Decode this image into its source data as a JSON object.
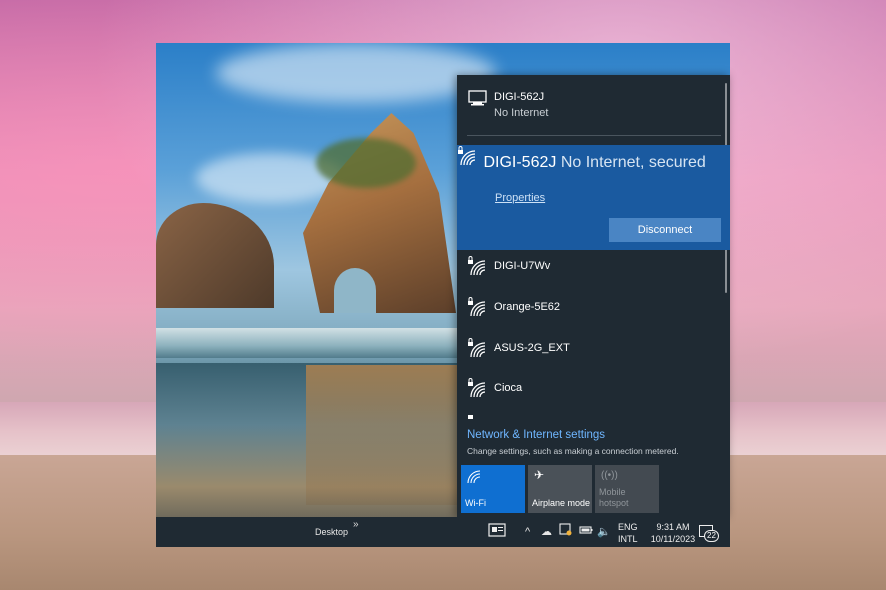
{
  "networks": [
    {
      "name": "DIGI-562J",
      "status": "No Internet",
      "icon": "ethernet-icon",
      "secured": false
    },
    {
      "name": "DIGI-562J",
      "status": "No Internet, secured",
      "icon": "wifi-secured-icon",
      "secured": true,
      "selected": true
    },
    {
      "name": "DIGI-U7Wv",
      "status": "",
      "icon": "wifi-secured-icon",
      "secured": true
    },
    {
      "name": "Orange-5E62",
      "status": "",
      "icon": "wifi-secured-icon",
      "secured": true
    },
    {
      "name": "ASUS-2G_EXT",
      "status": "",
      "icon": "wifi-secured-icon",
      "secured": true
    },
    {
      "name": "Cioca",
      "status": "",
      "icon": "wifi-secured-icon",
      "secured": true
    }
  ],
  "selected_network": {
    "properties_label": "Properties",
    "disconnect_label": "Disconnect"
  },
  "settings": {
    "link": "Network & Internet settings",
    "description": "Change settings, such as making a connection metered."
  },
  "quick_actions": [
    {
      "label": "Wi-Fi",
      "icon": "wifi-icon",
      "active": true
    },
    {
      "label": "Airplane mode",
      "icon": "airplane-icon",
      "active": false
    },
    {
      "label": "Mobile hotspot",
      "icon": "hotspot-icon",
      "active": false,
      "disabled": true
    }
  ],
  "taskbar": {
    "desktop_label": "Desktop",
    "chevron": "»",
    "language_line1": "ENG",
    "language_line2": "INTL",
    "time": "9:31 AM",
    "date": "10/11/2023",
    "notification_count": "22"
  },
  "colors": {
    "flyout_bg": "#1f2a33",
    "selected_bg": "#1a5aa0",
    "accent": "#0f6fd1",
    "link": "#6fb6ff"
  }
}
